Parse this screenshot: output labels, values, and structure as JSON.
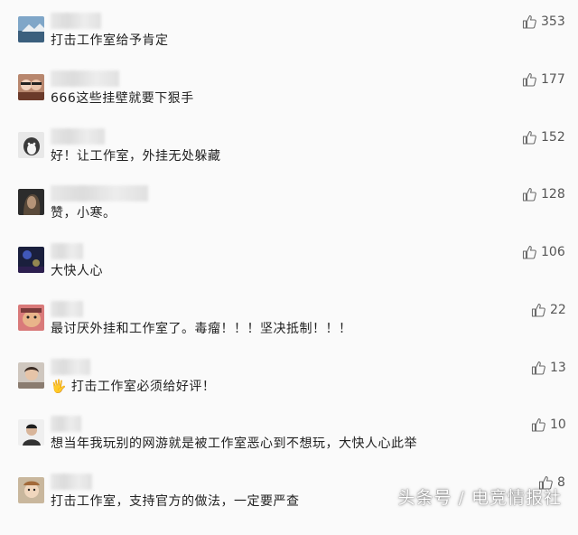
{
  "watermark": "头条号 / 电竞情报社",
  "comments": [
    {
      "text": "打击工作室给予肯定",
      "likes": "353"
    },
    {
      "text": "666这些挂壁就要下狠手",
      "likes": "177"
    },
    {
      "text": "好！让工作室，外挂无处躲藏",
      "likes": "152"
    },
    {
      "text": "赞，小寒。",
      "likes": "128"
    },
    {
      "text": "大快人心",
      "likes": "106"
    },
    {
      "text": "最讨厌外挂和工作室了。毒瘤！！！坚决抵制！！！",
      "likes": "22"
    },
    {
      "text": "🖐 打击工作室必须给好评！",
      "likes": "13"
    },
    {
      "text": "想当年我玩别的网游就是被工作室恶心到不想玩，大快人心此举",
      "likes": "10"
    },
    {
      "text": "打击工作室，支持官方的做法，一定要严查",
      "likes": "8"
    }
  ]
}
